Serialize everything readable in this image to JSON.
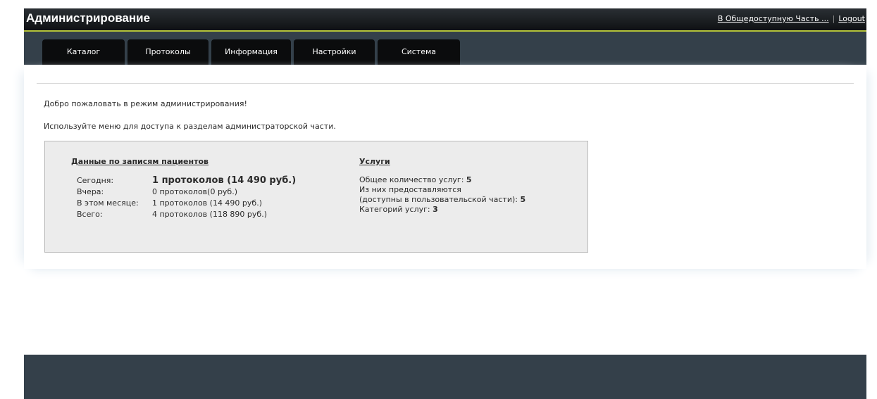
{
  "header": {
    "title": "Администрирование",
    "link_public": "В Общедоступную Часть ...",
    "separator": "|",
    "link_logout": "Logout"
  },
  "nav": {
    "tabs": [
      "Каталог",
      "Протоколы",
      "Информация",
      "Настройки",
      "Система"
    ]
  },
  "main": {
    "welcome": "Добро пожаловать в режим администрирования!",
    "hint": "Используйте меню для доступа к разделам администраторской части."
  },
  "patients": {
    "title": "Данные по записям пациентов",
    "rows": [
      {
        "label": "Сегодня:",
        "value": "1 протоколов (14 490 руб.)"
      },
      {
        "label": "Вчера:",
        "value": "0 протоколов(0 руб.)"
      },
      {
        "label": "В этом месяце:",
        "value": "1 протоколов (14 490 руб.)"
      },
      {
        "label": "Всего:",
        "value": "4 протоколов (118 890 руб.)"
      }
    ]
  },
  "services": {
    "title": "Услуги",
    "total_label": "Общее количество услуг:",
    "total_value": "5",
    "provided_line1": "Из них предоставляются",
    "provided_line2": "(доступны в пользовательской части):",
    "provided_value": "5",
    "categories_label": "Категорий услуг:",
    "categories_value": "3"
  },
  "colors": {
    "navbar": "#34404a",
    "accent": "#b5c33a",
    "tab_bg": "#0b0c0d",
    "stats_bg": "#ececec"
  }
}
